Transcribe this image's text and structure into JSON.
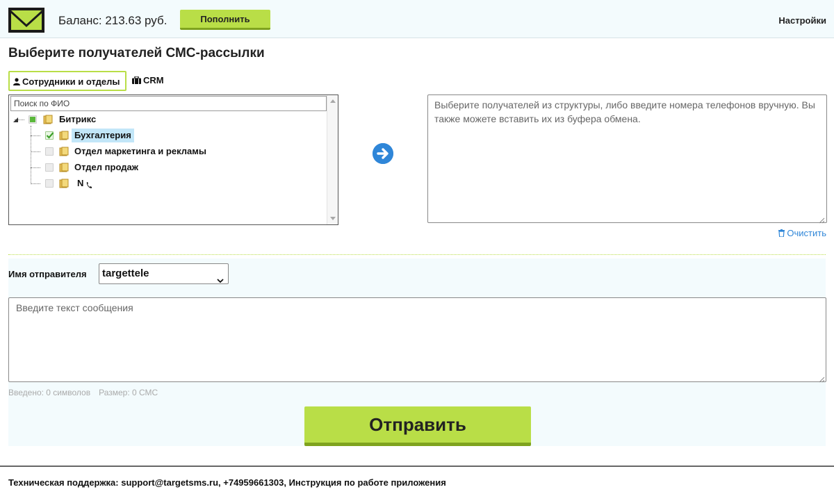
{
  "header": {
    "logo_icon": "envelope-icon",
    "balance_label": "Баланс: 213.63 руб.",
    "topup_label": "Пополнить",
    "settings_label": "Настройки"
  },
  "page_title": "Выберите получателей СМС-рассылки",
  "tabs": [
    {
      "label": "Сотрудники и отделы",
      "icon": "user-icon",
      "active": true
    },
    {
      "label": "CRM",
      "icon": "briefcase-icon",
      "active": false
    }
  ],
  "tree": {
    "search_placeholder": "Поиск по ФИО",
    "root": {
      "label": "Битрикс",
      "state": "partial"
    },
    "children": [
      {
        "label": "Бухгалтерия",
        "state": "checked",
        "selected": true
      },
      {
        "label": "Отдел маркетинга и рекламы",
        "state": "unchecked"
      },
      {
        "label": "Отдел продаж",
        "state": "unchecked"
      },
      {
        "label": "N",
        "state": "unchecked",
        "icon": "phone-icon"
      }
    ]
  },
  "recipients": {
    "placeholder": "Выберите получателей из структуры, либо введите номера телефонов вручную. Вы также можете вставить их из буфера обмена.",
    "clear_label": "Очистить"
  },
  "sender": {
    "label": "Имя отправителя",
    "selected": "targettele"
  },
  "message": {
    "placeholder": "Введите текст сообщения",
    "entered_label": "Введено: 0 символов",
    "size_label": "Размер: 0 СМС"
  },
  "send_label": "Отправить",
  "footer_text": "Техническая поддержка: support@targetsms.ru, +74959661303, Инструкция по работе приложения",
  "colors": {
    "accent_green": "#b9de47",
    "link_blue": "#2f86d8",
    "panel_bg": "#f3fbfd"
  }
}
